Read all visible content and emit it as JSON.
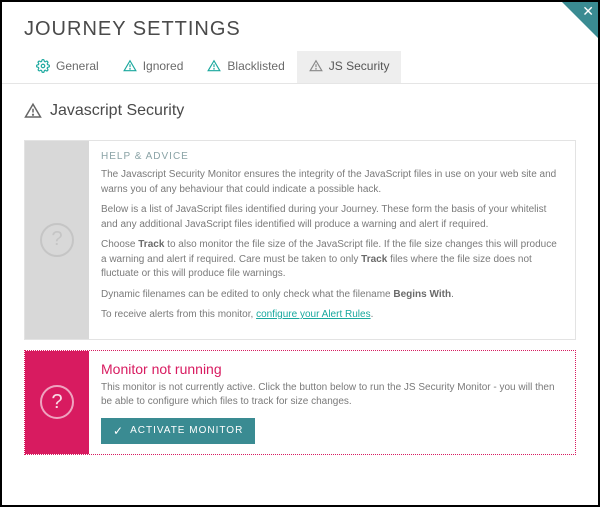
{
  "page": {
    "title": "JOURNEY SETTINGS"
  },
  "tabs": {
    "general": "General",
    "ignored": "Ignored",
    "blacklisted": "Blacklisted",
    "js_security": "JS Security"
  },
  "section": {
    "title": "Javascript Security"
  },
  "help": {
    "header": "HELP & ADVICE",
    "p1": "The Javascript Security Monitor ensures the integrity of the JavaScript files in use on your web site and warns you of any behaviour that could indicate a possible hack.",
    "p2": "Below is a list of JavaScript files identified during your Journey. These form the basis of your whitelist and any additional JavaScript files identified will produce a warning and alert if required.",
    "p3a": "Choose ",
    "p3_track1": "Track",
    "p3b": " to also monitor the file size of the JavaScript file. If the file size changes this will produce a warning and alert if required. Care must be taken to only ",
    "p3_track2": "Track",
    "p3c": " files where the file size does not fluctuate or this will produce file warnings.",
    "p4a": "Dynamic filenames can be edited to only check what the filename ",
    "p4_begins": "Begins With",
    "p4b": ".",
    "p5a": "To receive alerts from this monitor, ",
    "p5_link": "configure your Alert Rules",
    "p5b": "."
  },
  "alert": {
    "title": "Monitor not running",
    "text": "This monitor is not currently active. Click the button below to run the JS Security Monitor - you will then be able to configure which files to track for size changes.",
    "button": "ACTIVATE MONITOR"
  },
  "icons": {
    "question": "?",
    "check": "✓"
  }
}
